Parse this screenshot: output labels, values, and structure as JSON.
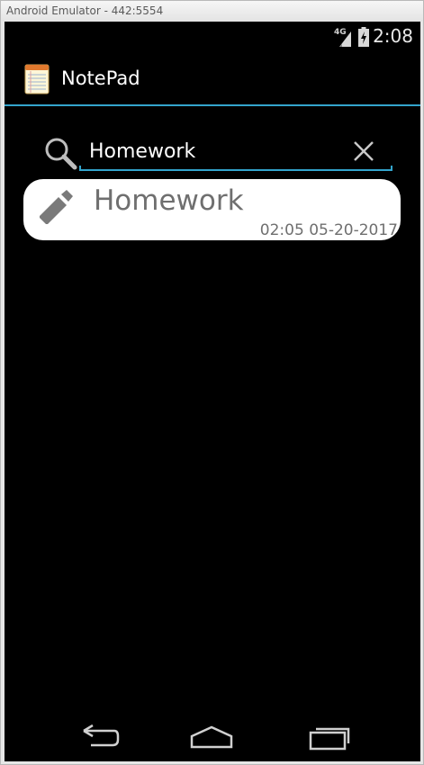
{
  "window": {
    "title": "Android Emulator - 442:5554"
  },
  "status_bar": {
    "network": "4G",
    "time": "2:08"
  },
  "action_bar": {
    "title": "NotePad",
    "icon": "notepad-icon"
  },
  "search": {
    "query": "Homework",
    "search_icon": "search-icon",
    "clear_icon": "close-icon"
  },
  "notes": [
    {
      "title": "Homework",
      "date": "02:05 05-20-2017",
      "icon": "pencil-icon"
    }
  ],
  "nav_bar": {
    "back_icon": "back-icon",
    "home_icon": "home-icon",
    "recents_icon": "recents-icon"
  },
  "colors": {
    "accent": "#33a4cc",
    "background": "#000000",
    "card": "#ffffff",
    "card_text": "#6f6f6f"
  }
}
